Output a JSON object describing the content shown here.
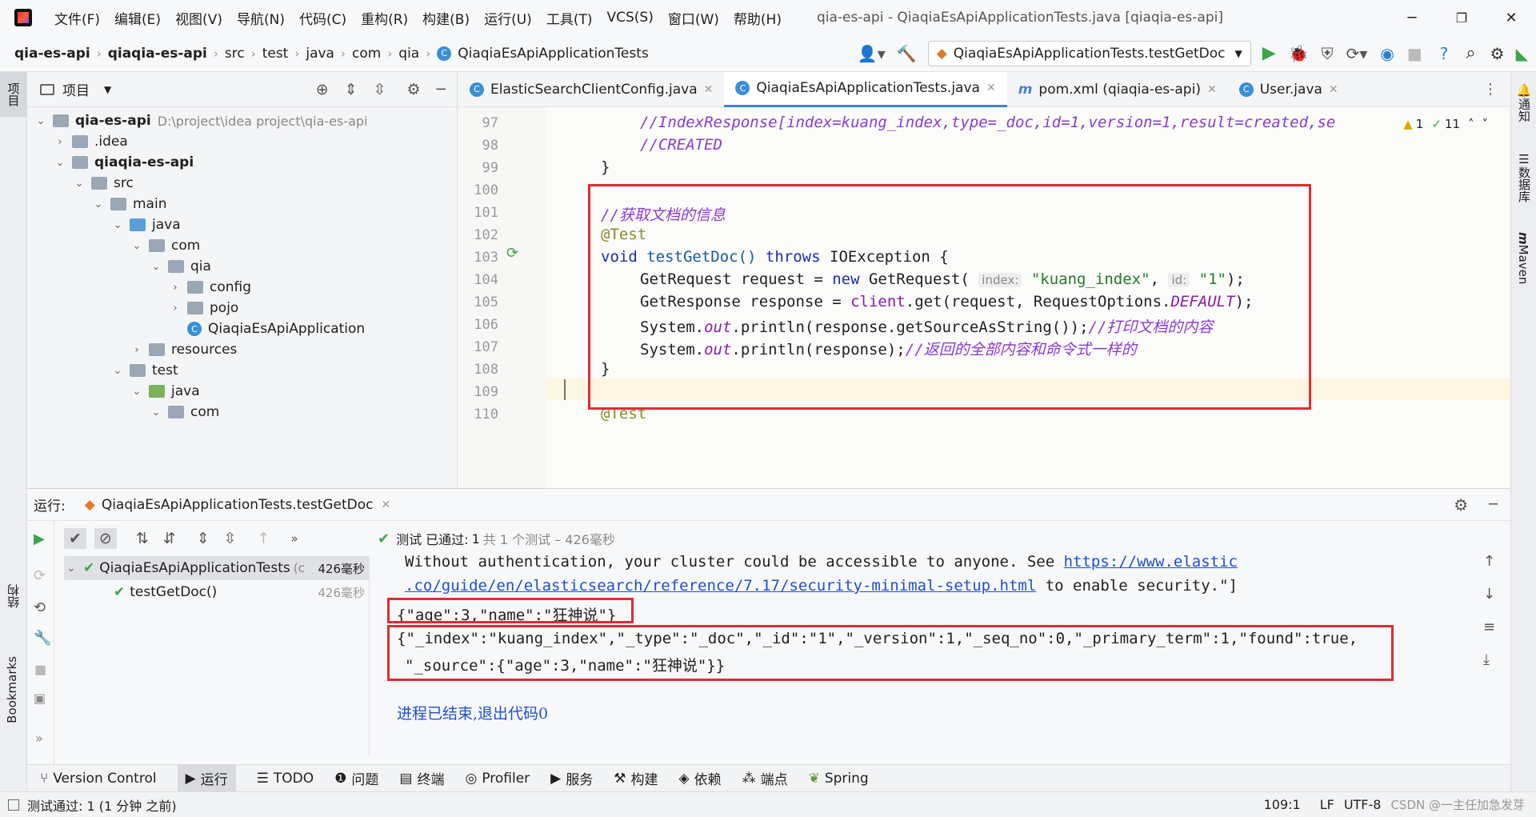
{
  "titlebar": {
    "menu": [
      "文件(F)",
      "编辑(E)",
      "视图(V)",
      "导航(N)",
      "代码(C)",
      "重构(R)",
      "构建(B)",
      "运行(U)",
      "工具(T)",
      "VCS(S)",
      "窗口(W)",
      "帮助(H)"
    ],
    "title": "qia-es-api - QiaqiaEsApiApplicationTests.java [qiaqia-es-api]"
  },
  "navbar": {
    "breadcrumbs": [
      "qia-es-api",
      "qiaqia-es-api",
      "src",
      "test",
      "java",
      "com",
      "qia",
      "QiaqiaEsApiApplicationTests"
    ],
    "run_config": "QiaqiaEsApiApplicationTests.testGetDoc"
  },
  "left_strip": {
    "project": "项目",
    "structure": "结构",
    "bookmarks": "Bookmarks"
  },
  "right_strip": {
    "notifications": "通知",
    "database": "数据库",
    "maven": "Maven"
  },
  "project_panel": {
    "title": "项目",
    "root_name": "qia-es-api",
    "root_path": "D:\\project\\idea project\\qia-es-api",
    "items": [
      {
        "label": ".idea"
      },
      {
        "label": "qiaqia-es-api"
      },
      {
        "label": "src"
      },
      {
        "label": "main"
      },
      {
        "label": "java"
      },
      {
        "label": "com"
      },
      {
        "label": "qia"
      },
      {
        "label": "config"
      },
      {
        "label": "pojo"
      },
      {
        "label": "QiaqiaEsApiApplication"
      },
      {
        "label": "resources"
      },
      {
        "label": "test"
      },
      {
        "label": "java"
      },
      {
        "label": "com"
      }
    ]
  },
  "editor": {
    "tabs": [
      {
        "label": "ElasticSearchClientConfig.java"
      },
      {
        "label": "QiaqiaEsApiApplicationTests.java"
      },
      {
        "label": "pom.xml (qiaqia-es-api)"
      },
      {
        "label": "User.java"
      }
    ],
    "warnings": "1",
    "checks": "11",
    "line_numbers": [
      "97",
      "98",
      "99",
      "100",
      "101",
      "102",
      "103",
      "104",
      "105",
      "106",
      "107",
      "108",
      "109",
      "110"
    ],
    "code": {
      "l97": "//IndexResponse[index=kuang_index,type=_doc,id=1,version=1,result=created,se",
      "l98": "//CREATED",
      "l99": "}",
      "l101": "//获取文档的信息",
      "l102": "@Test",
      "l103_void": "void",
      "l103_name": " testGetDoc() ",
      "l103_throws": "throws",
      "l103_rest": " IOException {",
      "l104_a": "GetRequest request = ",
      "l104_new": "new",
      "l104_b": " GetRequest(",
      "l104_hint1": "index:",
      "l104_s1": "\"kuang_index\"",
      "l104_c": ", ",
      "l104_hint2": "id:",
      "l104_s2": "\"1\"",
      "l104_d": ");",
      "l105_a": "GetResponse response = ",
      "l105_client": "client",
      "l105_b": ".get(request, RequestOptions.",
      "l105_default": "DEFAULT",
      "l105_c": ");",
      "l106_a": "System.",
      "l106_out": "out",
      "l106_b": ".println(response.getSourceAsString());",
      "l106_cm": "//打印文档的内容",
      "l107_a": "System.",
      "l107_out": "out",
      "l107_b": ".println(response);",
      "l107_cm": "//返回的全部内容和命令式一样的",
      "l108": "}",
      "l110": "@Test"
    }
  },
  "run_panel": {
    "label": "运行:",
    "tab": "QiaqiaEsApiApplicationTests.testGetDoc",
    "status_prefix": "测试 已通过:",
    "status_count": "1",
    "status_suffix": "共 1 个测试 – 426毫秒",
    "tests": [
      {
        "name": "QiaqiaEsApiApplicationTests",
        "extra": "(c",
        "time": "426毫秒"
      },
      {
        "name": "testGetDoc()",
        "time": "426毫秒"
      }
    ],
    "console": {
      "line1_text": "Without authentication, your cluster could be accessible to anyone. See ",
      "line1_link": "https://www.elastic",
      "line2_link": ".co/guide/en/elasticsearch/reference/7.17/security-minimal-setup.html",
      "line2_text": " to enable security.\"]",
      "source_output": "{\"age\":3,\"name\":\"狂神说\"}",
      "response_line1": "{\"_index\":\"kuang_index\",\"_type\":\"_doc\",\"_id\":\"1\",\"_version\":1,\"_seq_no\":0,\"_primary_term\":1,\"found\":true,",
      "response_line2": "\"_source\":{\"age\":3,\"name\":\"狂神说\"}}",
      "exit": "进程已结束,退出代码0"
    }
  },
  "bottom_tools": [
    "Version Control",
    "运行",
    "TODO",
    "问题",
    "终端",
    "Profiler",
    "服务",
    "构建",
    "依赖",
    "端点",
    "Spring"
  ],
  "statusbar": {
    "left": "测试通过: 1 (1 分钟 之前)",
    "position": "109:1",
    "lf": "LF",
    "encoding": "UTF-8",
    "watermark": "CSDN @一主任加急发芽"
  },
  "colors": {
    "accent": "#4083c9",
    "highlight_box": "#e22b33",
    "keyword": "#1b2ea8",
    "comment": "#8a3cd1",
    "string": "#227a2a",
    "success": "#3da34a"
  }
}
